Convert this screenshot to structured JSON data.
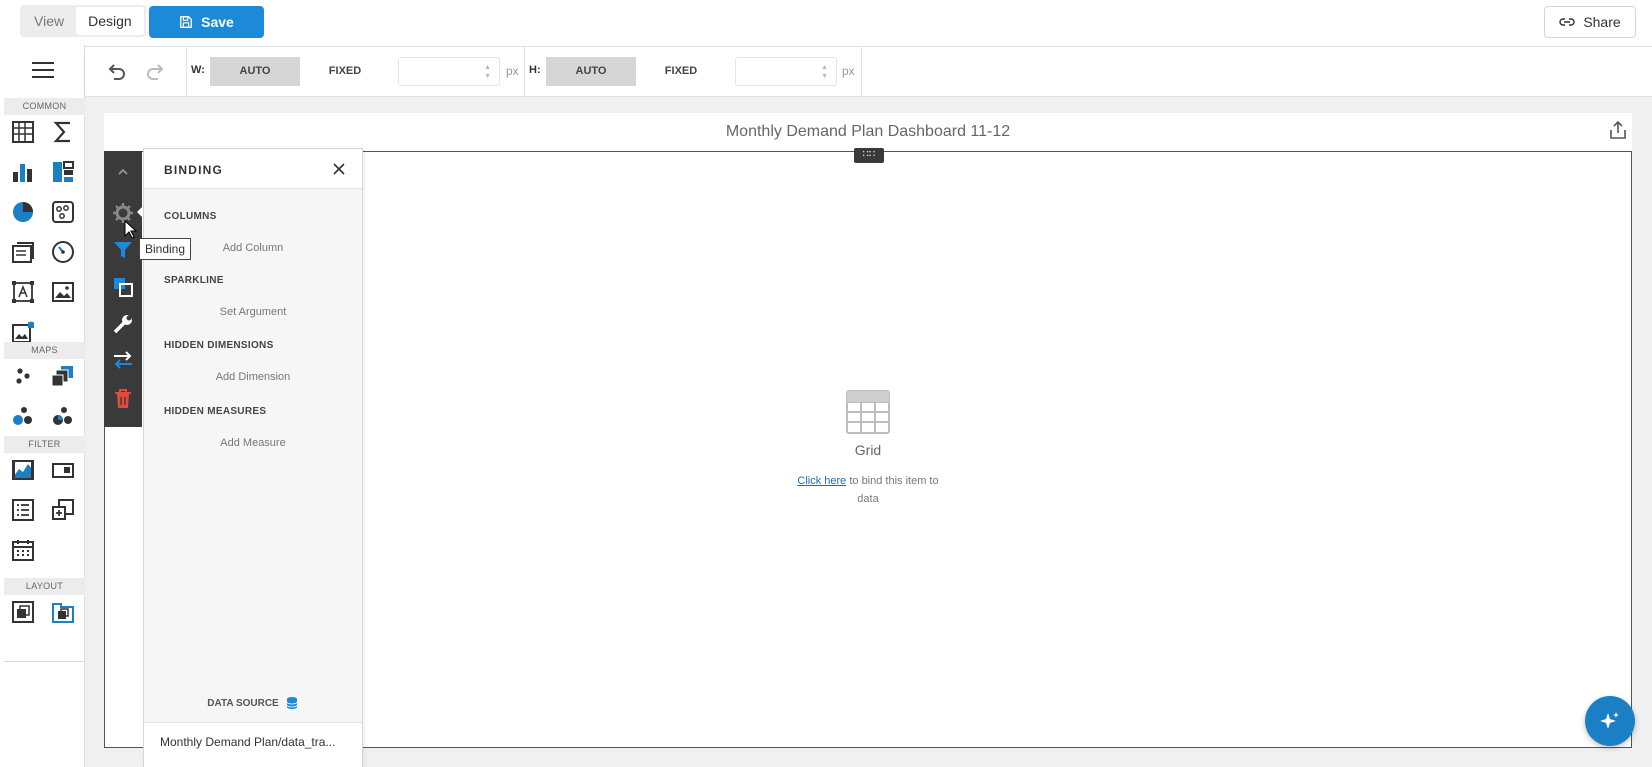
{
  "topbar": {
    "modes": [
      {
        "label": "View",
        "active": false
      },
      {
        "label": "Design",
        "active": true
      }
    ],
    "save_label": "Save",
    "share_label": "Share"
  },
  "toolbox": {
    "sections": {
      "common": "COMMON",
      "maps": "MAPS",
      "filter": "FILTER",
      "layout": "LAYOUT"
    },
    "icons": {
      "common": [
        "grid-icon",
        "pivot-sum-icon",
        "bar-chart-icon",
        "treemap-icon",
        "pie-chart-icon",
        "scatter-icon",
        "cards-icon",
        "gauge-icon",
        "text-box-icon",
        "image-icon",
        "bound-image-icon"
      ],
      "maps": [
        "geo-point-map-icon",
        "choropleth-map-icon",
        "bubble-map-icon",
        "pie-map-icon"
      ],
      "filter": [
        "range-filter-icon",
        "combo-box-icon",
        "list-box-icon",
        "tree-view-icon",
        "date-filter-icon"
      ],
      "layout": [
        "group-icon",
        "tab-container-icon"
      ]
    }
  },
  "property_toolbar": {
    "width_label": "W:",
    "height_label": "H:",
    "auto_label": "AUTO",
    "fixed_label": "FIXED",
    "unit": "px",
    "width_value": "",
    "height_value": ""
  },
  "dashboard": {
    "title": "Monthly Demand Plan Dashboard 11-12",
    "placeholder": {
      "title": "Grid",
      "link": "Click here",
      "text": " to bind this item to data"
    }
  },
  "binding_panel": {
    "title": "BINDING",
    "sections": [
      {
        "label": "COLUMNS",
        "action": "Add Column"
      },
      {
        "label": "SPARKLINE",
        "action": "Set Argument"
      },
      {
        "label": "HIDDEN DIMENSIONS",
        "action": "Add Dimension"
      },
      {
        "label": "HIDDEN MEASURES",
        "action": "Add Measure"
      }
    ],
    "data_source_label": "DATA SOURCE",
    "data_source_name": "Monthly Demand Plan/data_tra..."
  },
  "tooltip": "Binding",
  "colors": {
    "accent": "#1c8ad8",
    "rail": "#3a3a3a",
    "delete": "#e04b3c"
  }
}
